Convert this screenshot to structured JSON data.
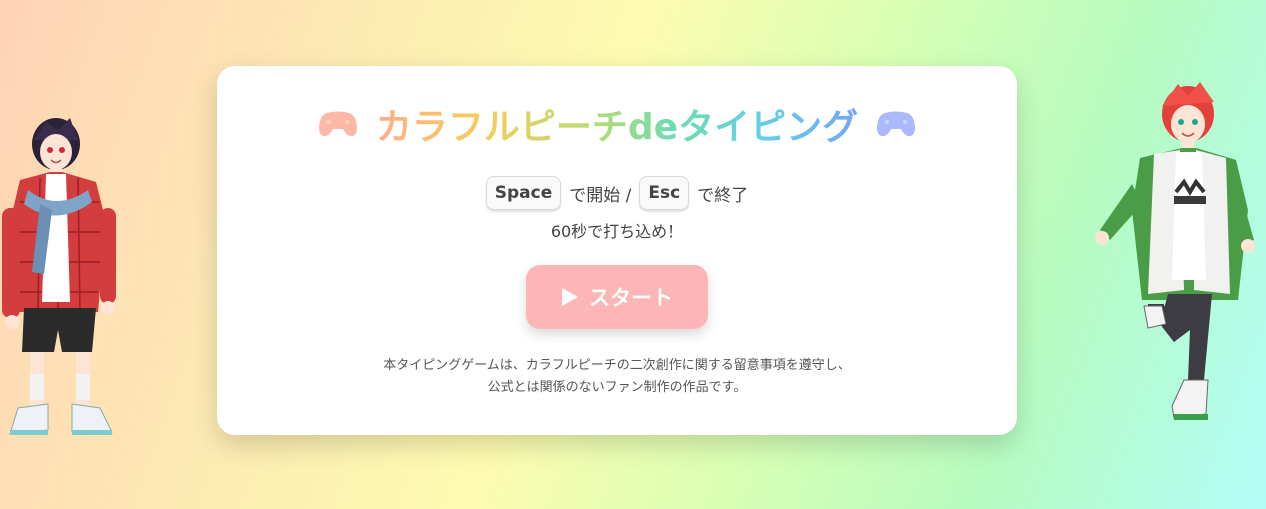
{
  "header": {
    "title": "カラフルピーチdeタイピング",
    "left_icon": "gamepad-icon",
    "right_icon": "gamepad-icon"
  },
  "controls": {
    "space_key": "Space",
    "start_text": "で開始 /",
    "esc_key": "Esc",
    "end_text": "で終了"
  },
  "tagline": "60秒で打ち込め！",
  "start_button": {
    "icon": "play-icon",
    "label": "スタート"
  },
  "notice": {
    "line1": "本タイピングゲームは、カラフルピーチの二次創作に関する留意事項を遵守し、",
    "line2": "公式とは関係のないファン制作の作品です。"
  },
  "colors": {
    "start_button": "#fdb6b6",
    "gamepad_left": "#ffb8a6",
    "gamepad_right": "#a9b8ff"
  }
}
